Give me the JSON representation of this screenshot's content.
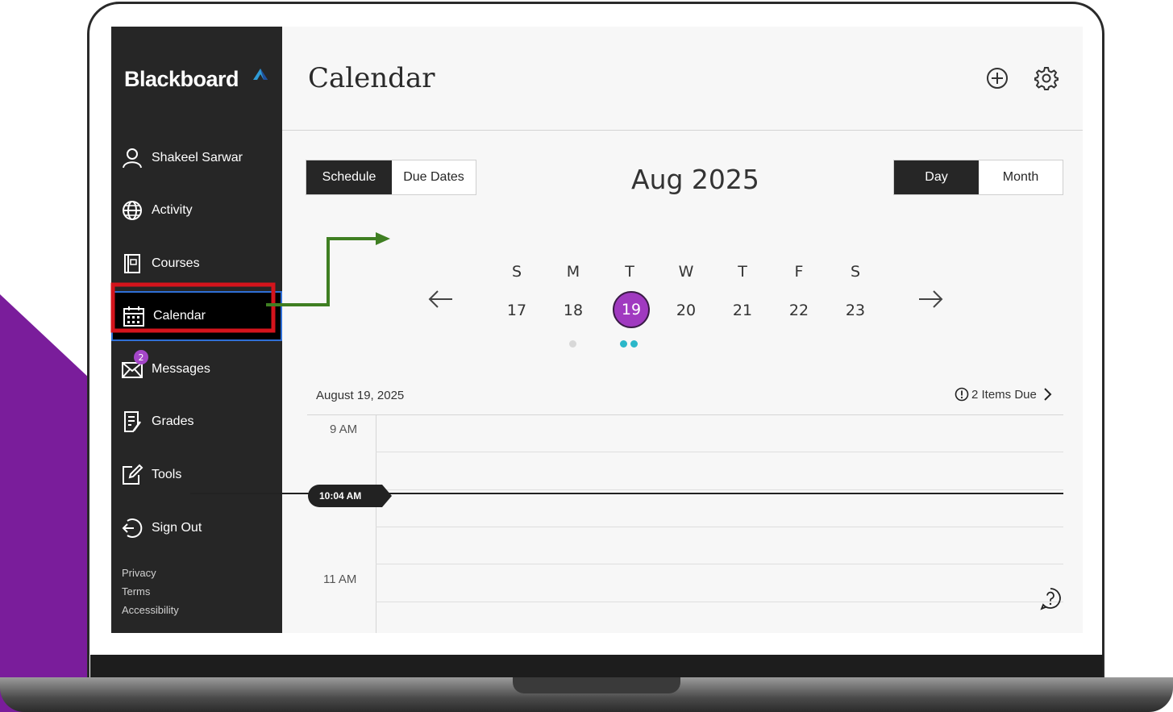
{
  "sidebar": {
    "logo": "Blackboard",
    "user": "Shakeel Sarwar",
    "items": [
      {
        "label": "Activity"
      },
      {
        "label": "Courses"
      },
      {
        "label": "Calendar"
      },
      {
        "label": "Messages",
        "badge": "2"
      },
      {
        "label": "Grades"
      },
      {
        "label": "Tools"
      },
      {
        "label": "Sign Out"
      }
    ],
    "footer": [
      "Privacy",
      "Terms",
      "Accessibility"
    ]
  },
  "header": {
    "title": "Calendar",
    "add_icon": "plus-circle-icon",
    "settings_icon": "gear-icon"
  },
  "view_tabs": {
    "schedule": "Schedule",
    "due_dates": "Due Dates",
    "active": "Schedule"
  },
  "range_tabs": {
    "day": "Day",
    "month": "Month",
    "active": "Day"
  },
  "month_title": "Aug 2025",
  "week": {
    "days": [
      "S",
      "M",
      "T",
      "W",
      "T",
      "F",
      "S"
    ],
    "dates": [
      "17",
      "18",
      "19",
      "20",
      "21",
      "22",
      "23"
    ],
    "selected": "19"
  },
  "agenda": {
    "date": "August 19, 2025",
    "items_due": "2 Items Due",
    "times": [
      "9 AM",
      "11 AM"
    ],
    "current_time": "10:04 AM"
  },
  "colors": {
    "sidebar_bg": "#262626",
    "accent_purple": "#a03ac0",
    "event_teal": "#2bb7c9",
    "annotation_red": "#d4141c",
    "annotation_green": "#3f7f22",
    "background_purple": "#7a1d9b"
  }
}
